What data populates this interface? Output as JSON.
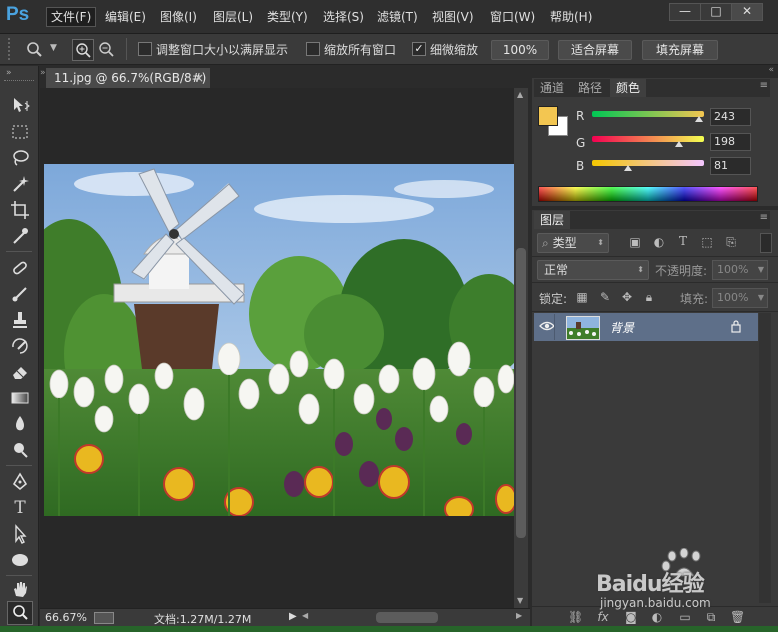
{
  "app": {
    "logo": "Ps"
  },
  "menu": [
    {
      "label": "文件(F)"
    },
    {
      "label": "编辑(E)"
    },
    {
      "label": "图像(I)"
    },
    {
      "label": "图层(L)"
    },
    {
      "label": "类型(Y)"
    },
    {
      "label": "选择(S)"
    },
    {
      "label": "滤镜(T)"
    },
    {
      "label": "视图(V)"
    },
    {
      "label": "窗口(W)"
    },
    {
      "label": "帮助(H)"
    }
  ],
  "window_controls": {
    "minimize": "—",
    "restore": "□",
    "close": "✕"
  },
  "options": {
    "resize_windows_label": "调整窗口大小以满屏显示",
    "zoom_all_label": "缩放所有窗口",
    "scrubby_zoom_label": "细微缩放",
    "scrubby_zoom_checked": true,
    "pct_100": "100%",
    "fit_screen": "适合屏幕",
    "fill_screen": "填充屏幕"
  },
  "document": {
    "tab_title": "11.jpg @ 66.7%(RGB/8#)",
    "tab_close": "×",
    "zoom": "66.67%",
    "doc_info": "文档:1.27M/1.27M"
  },
  "color_panel": {
    "tabs": [
      {
        "label": "通道"
      },
      {
        "label": "路径"
      },
      {
        "label": "颜色"
      }
    ],
    "foreground": "#F3C651",
    "background": "#FFFFFF",
    "channels": [
      {
        "label": "R",
        "value": "243",
        "fraction": 0.953
      },
      {
        "label": "G",
        "value": "198",
        "fraction": 0.776
      },
      {
        "label": "B",
        "value": "81",
        "fraction": 0.318
      }
    ]
  },
  "layers_panel": {
    "tab": "图层",
    "filter_kind": "类型",
    "blend_mode": "正常",
    "opacity_label": "不透明度:",
    "opacity_value": "100%",
    "lock_label": "锁定:",
    "fill_label": "填充:",
    "fill_value": "100%",
    "layers": [
      {
        "name": "背景",
        "visible": true,
        "locked": true
      }
    ]
  },
  "watermark": {
    "brand": "Baidu经验",
    "url": "jingyan.baidu.com"
  }
}
